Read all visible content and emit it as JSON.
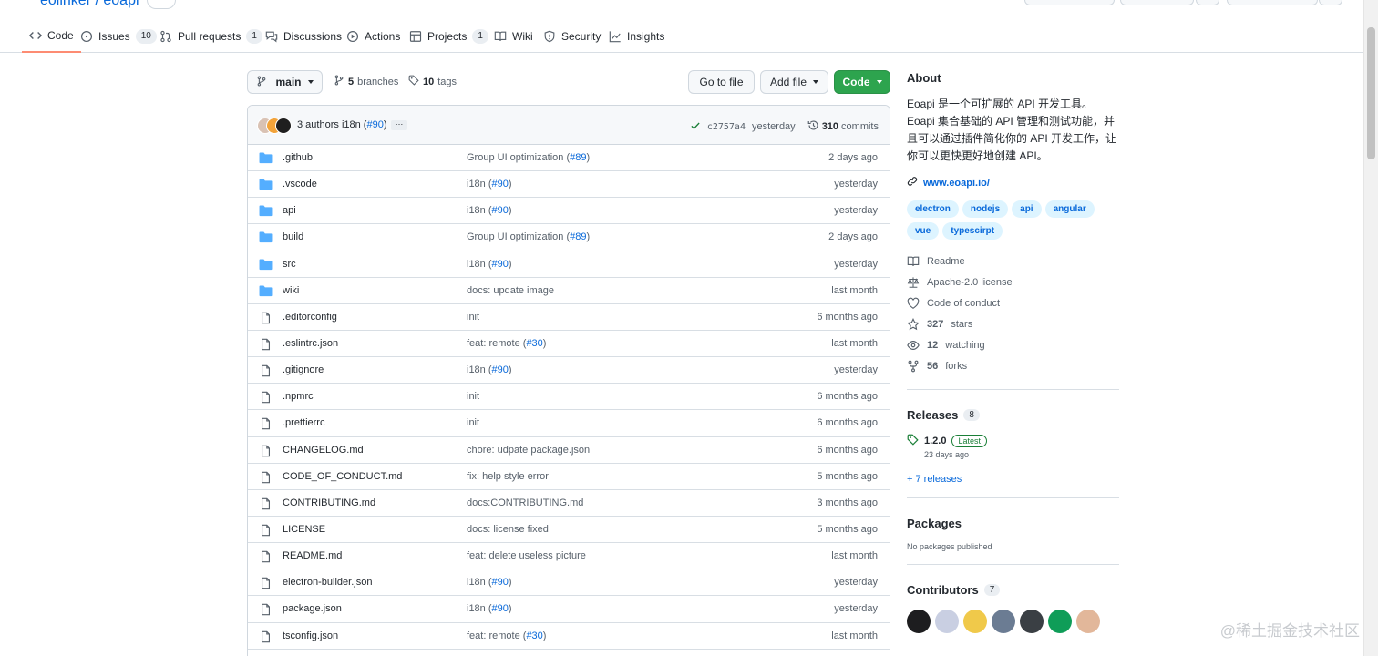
{
  "repo": {
    "owner": "eolinker",
    "name": "eoapi"
  },
  "tabs": [
    {
      "label": "Code",
      "icon": "code-icon"
    },
    {
      "label": "Issues",
      "count": "10",
      "icon": "issue-icon"
    },
    {
      "label": "Pull requests",
      "count": "1",
      "icon": "pull-request-icon"
    },
    {
      "label": "Discussions",
      "icon": "discussion-icon"
    },
    {
      "label": "Actions",
      "icon": "play-icon"
    },
    {
      "label": "Projects",
      "count": "1",
      "icon": "table-icon"
    },
    {
      "label": "Wiki",
      "icon": "book-icon"
    },
    {
      "label": "Security",
      "icon": "shield-icon"
    },
    {
      "label": "Insights",
      "icon": "graph-icon"
    }
  ],
  "toolbar": {
    "branch": "main",
    "branches_count": "5",
    "branches_label": "branches",
    "tags_count": "10",
    "tags_label": "tags",
    "go_to_file": "Go to file",
    "add_file": "Add file",
    "code": "Code"
  },
  "commit": {
    "authors": "3 authors",
    "message": "i18n",
    "pr": "#90",
    "ellipsis": "…",
    "sha": "c2757a4",
    "time": "yesterday",
    "commits_count": "310",
    "commits_label": "commits"
  },
  "files": [
    {
      "type": "dir",
      "name": ".github",
      "msg": "Group UI optimization",
      "pr": "#89",
      "age": "2 days ago"
    },
    {
      "type": "dir",
      "name": ".vscode",
      "msg": "i18n",
      "pr": "#90",
      "age": "yesterday"
    },
    {
      "type": "dir",
      "name": "api",
      "msg": "i18n",
      "pr": "#90",
      "age": "yesterday"
    },
    {
      "type": "dir",
      "name": "build",
      "msg": "Group UI optimization",
      "pr": "#89",
      "age": "2 days ago"
    },
    {
      "type": "dir",
      "name": "src",
      "msg": "i18n",
      "pr": "#90",
      "age": "yesterday"
    },
    {
      "type": "dir",
      "name": "wiki",
      "msg": "docs: update image",
      "pr": "",
      "age": "last month"
    },
    {
      "type": "file",
      "name": ".editorconfig",
      "msg": "init",
      "pr": "",
      "age": "6 months ago"
    },
    {
      "type": "file",
      "name": ".eslintrc.json",
      "msg": "feat: remote",
      "pr": "#30",
      "age": "last month"
    },
    {
      "type": "file",
      "name": ".gitignore",
      "msg": "i18n",
      "pr": "#90",
      "age": "yesterday"
    },
    {
      "type": "file",
      "name": ".npmrc",
      "msg": "init",
      "pr": "",
      "age": "6 months ago"
    },
    {
      "type": "file",
      "name": ".prettierrc",
      "msg": "init",
      "pr": "",
      "age": "6 months ago"
    },
    {
      "type": "file",
      "name": "CHANGELOG.md",
      "msg": "chore: udpate package.json",
      "pr": "",
      "age": "6 months ago"
    },
    {
      "type": "file",
      "name": "CODE_OF_CONDUCT.md",
      "msg": "fix: help style error",
      "pr": "",
      "age": "5 months ago"
    },
    {
      "type": "file",
      "name": "CONTRIBUTING.md",
      "msg": "docs:CONTRIBUTING.md",
      "pr": "",
      "age": "3 months ago"
    },
    {
      "type": "file",
      "name": "LICENSE",
      "msg": "docs: license fixed",
      "pr": "",
      "age": "5 months ago"
    },
    {
      "type": "file",
      "name": "README.md",
      "msg": "feat: delete useless picture",
      "pr": "",
      "age": "last month"
    },
    {
      "type": "file",
      "name": "electron-builder.json",
      "msg": "i18n",
      "pr": "#90",
      "age": "yesterday"
    },
    {
      "type": "file",
      "name": "package.json",
      "msg": "i18n",
      "pr": "#90",
      "age": "yesterday"
    },
    {
      "type": "file",
      "name": "tsconfig.json",
      "msg": "feat: remote",
      "pr": "#30",
      "age": "last month"
    }
  ],
  "about": {
    "title": "About",
    "description": "Eoapi 是一个可扩展的 API 开发工具。Eoapi 集合基础的 API 管理和测试功能，并且可以通过插件简化你的 API 开发工作，让你可以更快更好地创建 API。",
    "website": "www.eoapi.io/",
    "topics": [
      "electron",
      "nodejs",
      "api",
      "angular",
      "vue",
      "typescirpt"
    ],
    "meta": [
      {
        "icon": "book-icon",
        "value": "",
        "label": "Readme"
      },
      {
        "icon": "law-icon",
        "value": "",
        "label": "Apache-2.0 license"
      },
      {
        "icon": "heart-icon",
        "value": "",
        "label": "Code of conduct"
      },
      {
        "icon": "star-icon",
        "value": "327",
        "label": "stars"
      },
      {
        "icon": "eye-icon",
        "value": "12",
        "label": "watching"
      },
      {
        "icon": "fork-icon",
        "value": "56",
        "label": "forks"
      }
    ]
  },
  "releases": {
    "title": "Releases",
    "count": "8",
    "latest_tag": "1.2.0",
    "latest_badge": "Latest",
    "latest_date": "23 days ago",
    "more": "+ 7 releases"
  },
  "packages": {
    "title": "Packages",
    "text": "No packages published"
  },
  "contributors": {
    "title": "Contributors",
    "count": "7"
  },
  "watermark": "@稀土掘金技术社区",
  "colors": {
    "accent": "#0969da",
    "green": "#2da44e",
    "folder": "#54aeff",
    "tab_underline": "#fd8c73"
  }
}
